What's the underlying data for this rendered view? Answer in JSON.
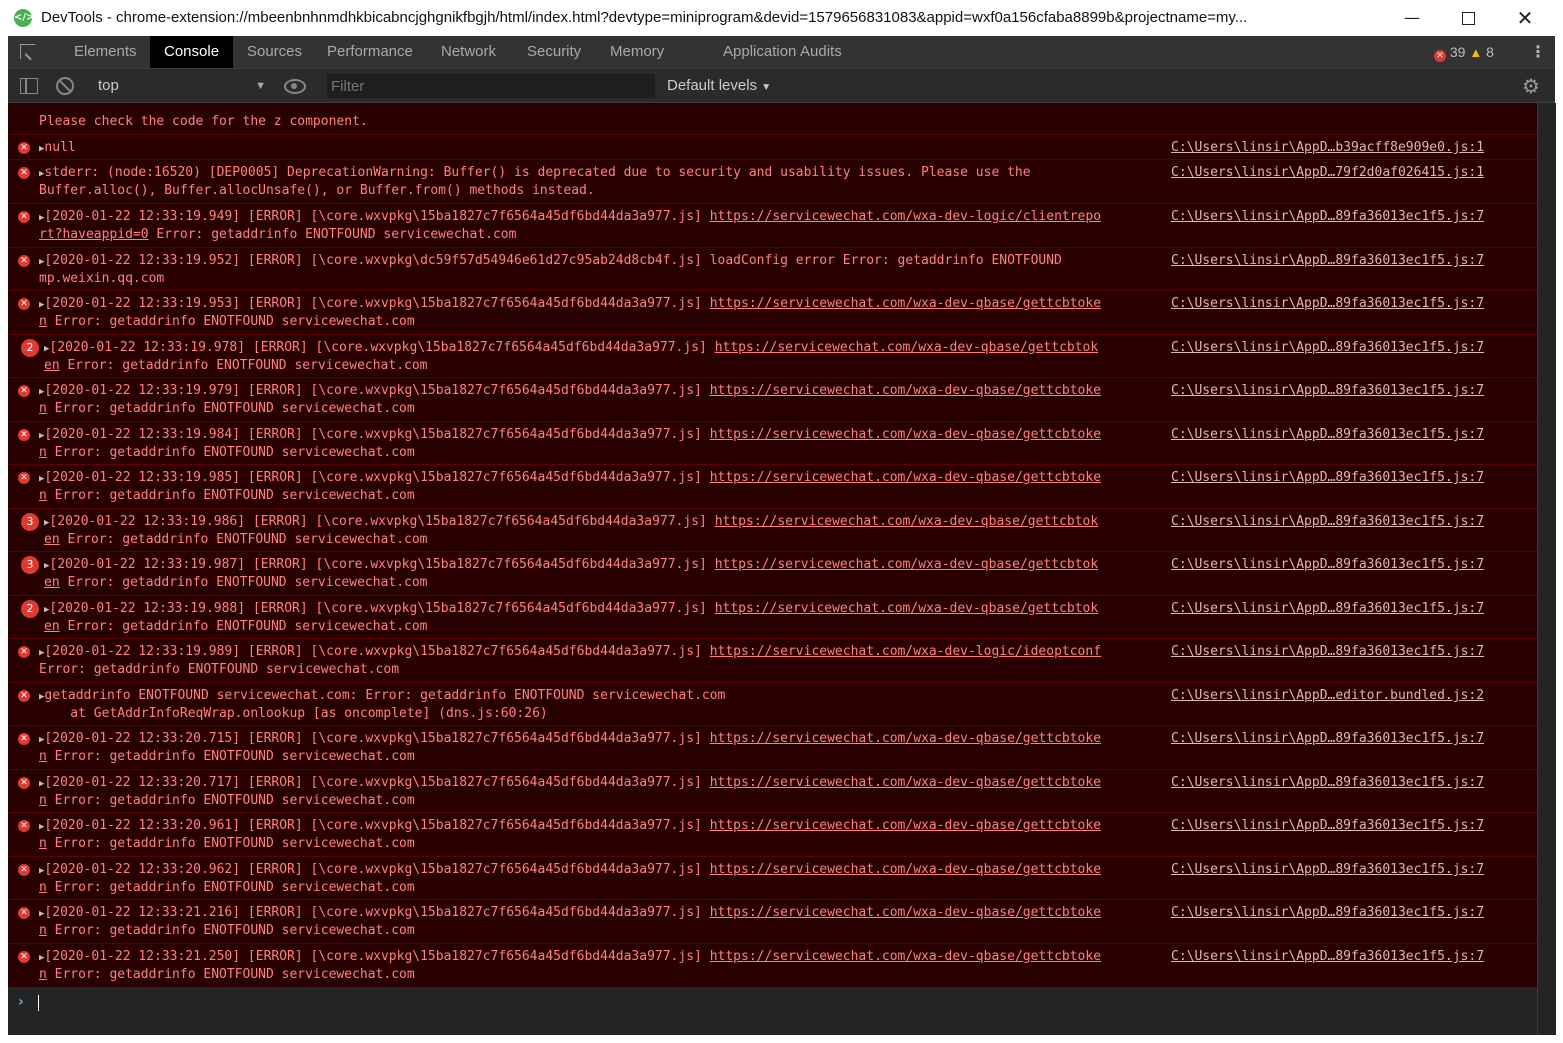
{
  "window": {
    "title": "DevTools - chrome-extension://mbeenbnhnmdhkbicabncjghgnikfbgjh/html/index.html?devtype=miniprogram&devid=1579656831083&appid=wxf0a156cfaba8899b&projectname=my...",
    "minimize_icon": "minimize-icon",
    "maximize_icon": "maximize-icon",
    "close_icon": "close-icon"
  },
  "tabs": [
    {
      "label": "Elements"
    },
    {
      "label": "Console",
      "active": true
    },
    {
      "label": "Sources"
    },
    {
      "label": "Performance"
    },
    {
      "label": "Network"
    },
    {
      "label": "Security"
    },
    {
      "label": "Memory"
    },
    {
      "label": "Application"
    },
    {
      "label": "Audits"
    }
  ],
  "counts": {
    "errors": "39",
    "warnings": "8"
  },
  "toolbar": {
    "context": "top",
    "filter_placeholder": "Filter",
    "levels": "Default levels"
  },
  "colors": {
    "console_bg": "#290000",
    "error_text": "#ff8080",
    "error_badge": "#e0392f",
    "prompt": "#5db0ff"
  },
  "messages": [
    {
      "icon": "none",
      "line1": "Please check the code for the z component.",
      "line2": "",
      "source": ""
    },
    {
      "icon": "error",
      "line1": "null",
      "line2": "",
      "source": "C:\\Users\\linsir\\AppD…b39acff8e909e0.js:1"
    },
    {
      "icon": "error",
      "line1": "stderr: (node:16520) [DEP0005] DeprecationWarning: Buffer() is deprecated due to security and usability issues. Please use the",
      "line2": "Buffer.alloc(), Buffer.allocUnsafe(), or Buffer.from() methods instead.",
      "source": "C:\\Users\\linsir\\AppD…79f2d0af026415.js:1"
    },
    {
      "icon": "error",
      "line1": "[2020-01-22 12:33:19.949] [ERROR] [\\core.wxvpkg\\15ba1827c7f6564a45df6bd44da3a977.js] ",
      "link": "https://servicewechat.com/wxa-dev-logic/clientrepo",
      "link2": "rt?haveappid=0",
      "line2": " Error: getaddrinfo ENOTFOUND servicewechat.com",
      "source": "C:\\Users\\linsir\\AppD…89fa36013ec1f5.js:7"
    },
    {
      "icon": "error",
      "line1": "[2020-01-22 12:33:19.952] [ERROR] [\\core.wxvpkg\\dc59f57d54946e61d27c95ab24d8cb4f.js] loadConfig error Error: getaddrinfo ENOTFOUND",
      "line2": "mp.weixin.qq.com",
      "source": "C:\\Users\\linsir\\AppD…89fa36013ec1f5.js:7"
    },
    {
      "icon": "error",
      "line1": "[2020-01-22 12:33:19.953] [ERROR] [\\core.wxvpkg\\15ba1827c7f6564a45df6bd44da3a977.js] ",
      "link": "https://servicewechat.com/wxa-dev-qbase/gettcbtoke",
      "link2": "n",
      "line2": " Error: getaddrinfo ENOTFOUND servicewechat.com",
      "source": "C:\\Users\\linsir\\AppD…89fa36013ec1f5.js:7"
    },
    {
      "icon": "2",
      "line1": "[2020-01-22 12:33:19.978] [ERROR] [\\core.wxvpkg\\15ba1827c7f6564a45df6bd44da3a977.js] ",
      "link": "https://servicewechat.com/wxa-dev-qbase/gettcbtok",
      "link2": "en",
      "line2": " Error: getaddrinfo ENOTFOUND servicewechat.com",
      "source": "C:\\Users\\linsir\\AppD…89fa36013ec1f5.js:7"
    },
    {
      "icon": "error",
      "line1": "[2020-01-22 12:33:19.979] [ERROR] [\\core.wxvpkg\\15ba1827c7f6564a45df6bd44da3a977.js] ",
      "link": "https://servicewechat.com/wxa-dev-qbase/gettcbtoke",
      "link2": "n",
      "line2": " Error: getaddrinfo ENOTFOUND servicewechat.com",
      "source": "C:\\Users\\linsir\\AppD…89fa36013ec1f5.js:7"
    },
    {
      "icon": "error",
      "line1": "[2020-01-22 12:33:19.984] [ERROR] [\\core.wxvpkg\\15ba1827c7f6564a45df6bd44da3a977.js] ",
      "link": "https://servicewechat.com/wxa-dev-qbase/gettcbtoke",
      "link2": "n",
      "line2": " Error: getaddrinfo ENOTFOUND servicewechat.com",
      "source": "C:\\Users\\linsir\\AppD…89fa36013ec1f5.js:7"
    },
    {
      "icon": "error",
      "line1": "[2020-01-22 12:33:19.985] [ERROR] [\\core.wxvpkg\\15ba1827c7f6564a45df6bd44da3a977.js] ",
      "link": "https://servicewechat.com/wxa-dev-qbase/gettcbtoke",
      "link2": "n",
      "line2": " Error: getaddrinfo ENOTFOUND servicewechat.com",
      "source": "C:\\Users\\linsir\\AppD…89fa36013ec1f5.js:7"
    },
    {
      "icon": "3",
      "line1": "[2020-01-22 12:33:19.986] [ERROR] [\\core.wxvpkg\\15ba1827c7f6564a45df6bd44da3a977.js] ",
      "link": "https://servicewechat.com/wxa-dev-qbase/gettcbtok",
      "link2": "en",
      "line2": " Error: getaddrinfo ENOTFOUND servicewechat.com",
      "source": "C:\\Users\\linsir\\AppD…89fa36013ec1f5.js:7"
    },
    {
      "icon": "3",
      "line1": "[2020-01-22 12:33:19.987] [ERROR] [\\core.wxvpkg\\15ba1827c7f6564a45df6bd44da3a977.js] ",
      "link": "https://servicewechat.com/wxa-dev-qbase/gettcbtok",
      "link2": "en",
      "line2": " Error: getaddrinfo ENOTFOUND servicewechat.com",
      "source": "C:\\Users\\linsir\\AppD…89fa36013ec1f5.js:7"
    },
    {
      "icon": "2",
      "line1": "[2020-01-22 12:33:19.988] [ERROR] [\\core.wxvpkg\\15ba1827c7f6564a45df6bd44da3a977.js] ",
      "link": "https://servicewechat.com/wxa-dev-qbase/gettcbtok",
      "link2": "en",
      "line2": " Error: getaddrinfo ENOTFOUND servicewechat.com",
      "source": "C:\\Users\\linsir\\AppD…89fa36013ec1f5.js:7"
    },
    {
      "icon": "error",
      "line1": "[2020-01-22 12:33:19.989] [ERROR] [\\core.wxvpkg\\15ba1827c7f6564a45df6bd44da3a977.js] ",
      "link": "https://servicewechat.com/wxa-dev-logic/ideoptconf",
      "line2": "Error: getaddrinfo ENOTFOUND servicewechat.com",
      "source": "C:\\Users\\linsir\\AppD…89fa36013ec1f5.js:7"
    },
    {
      "icon": "error",
      "line1": "getaddrinfo ENOTFOUND servicewechat.com: Error: getaddrinfo ENOTFOUND servicewechat.com",
      "line2": "    at GetAddrInfoReqWrap.onlookup [as oncomplete] (dns.js:60:26)",
      "source": "C:\\Users\\linsir\\AppD…editor.bundled.js:2"
    },
    {
      "icon": "error",
      "line1": "[2020-01-22 12:33:20.715] [ERROR] [\\core.wxvpkg\\15ba1827c7f6564a45df6bd44da3a977.js] ",
      "link": "https://servicewechat.com/wxa-dev-qbase/gettcbtoke",
      "link2": "n",
      "line2": " Error: getaddrinfo ENOTFOUND servicewechat.com",
      "source": "C:\\Users\\linsir\\AppD…89fa36013ec1f5.js:7"
    },
    {
      "icon": "error",
      "line1": "[2020-01-22 12:33:20.717] [ERROR] [\\core.wxvpkg\\15ba1827c7f6564a45df6bd44da3a977.js] ",
      "link": "https://servicewechat.com/wxa-dev-qbase/gettcbtoke",
      "link2": "n",
      "line2": " Error: getaddrinfo ENOTFOUND servicewechat.com",
      "source": "C:\\Users\\linsir\\AppD…89fa36013ec1f5.js:7"
    },
    {
      "icon": "error",
      "line1": "[2020-01-22 12:33:20.961] [ERROR] [\\core.wxvpkg\\15ba1827c7f6564a45df6bd44da3a977.js] ",
      "link": "https://servicewechat.com/wxa-dev-qbase/gettcbtoke",
      "link2": "n",
      "line2": " Error: getaddrinfo ENOTFOUND servicewechat.com",
      "source": "C:\\Users\\linsir\\AppD…89fa36013ec1f5.js:7"
    },
    {
      "icon": "error",
      "line1": "[2020-01-22 12:33:20.962] [ERROR] [\\core.wxvpkg\\15ba1827c7f6564a45df6bd44da3a977.js] ",
      "link": "https://servicewechat.com/wxa-dev-qbase/gettcbtoke",
      "link2": "n",
      "line2": " Error: getaddrinfo ENOTFOUND servicewechat.com",
      "source": "C:\\Users\\linsir\\AppD…89fa36013ec1f5.js:7"
    },
    {
      "icon": "error",
      "line1": "[2020-01-22 12:33:21.216] [ERROR] [\\core.wxvpkg\\15ba1827c7f6564a45df6bd44da3a977.js] ",
      "link": "https://servicewechat.com/wxa-dev-qbase/gettcbtoke",
      "link2": "n",
      "line2": " Error: getaddrinfo ENOTFOUND servicewechat.com",
      "source": "C:\\Users\\linsir\\AppD…89fa36013ec1f5.js:7"
    },
    {
      "icon": "error",
      "line1": "[2020-01-22 12:33:21.250] [ERROR] [\\core.wxvpkg\\15ba1827c7f6564a45df6bd44da3a977.js] ",
      "link": "https://servicewechat.com/wxa-dev-qbase/gettcbtoke",
      "link2": "n",
      "line2": " Error: getaddrinfo ENOTFOUND servicewechat.com",
      "source": "C:\\Users\\linsir\\AppD…89fa36013ec1f5.js:7"
    }
  ]
}
